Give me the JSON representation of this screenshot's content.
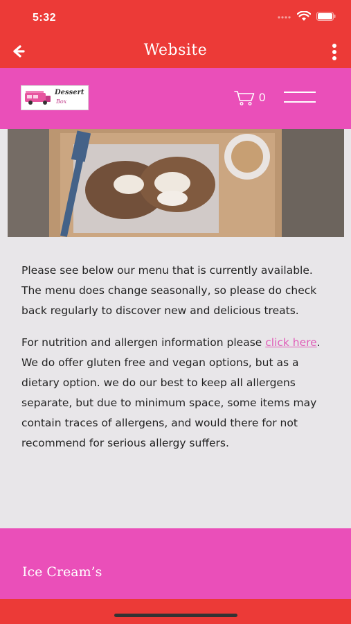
{
  "status": {
    "time": "5:32"
  },
  "nav": {
    "title": "Website"
  },
  "header": {
    "logo_line1": "Dessert",
    "logo_line2": "Box",
    "cart_count": "0"
  },
  "content": {
    "p1": " Please see below our menu that is currently available. The menu does change seasonally, so please do check back regularly to discover new and delicious treats.",
    "p2_before": " For nutrition and allergen information please ",
    "p2_link": "click here",
    "p2_after": ".   We do offer gluten free and vegan options, but as a dietary option. we do our best to keep all allergens separate, but due to minimum space, some items may contain traces of allergens, and would there for not recommend for serious allergy suffers."
  },
  "section": {
    "heading": "Ice Cream’s"
  },
  "colors": {
    "red": "#ec3a37",
    "pink": "#ea4fb9",
    "link": "#e05db8",
    "background": "#e8e6e9"
  }
}
